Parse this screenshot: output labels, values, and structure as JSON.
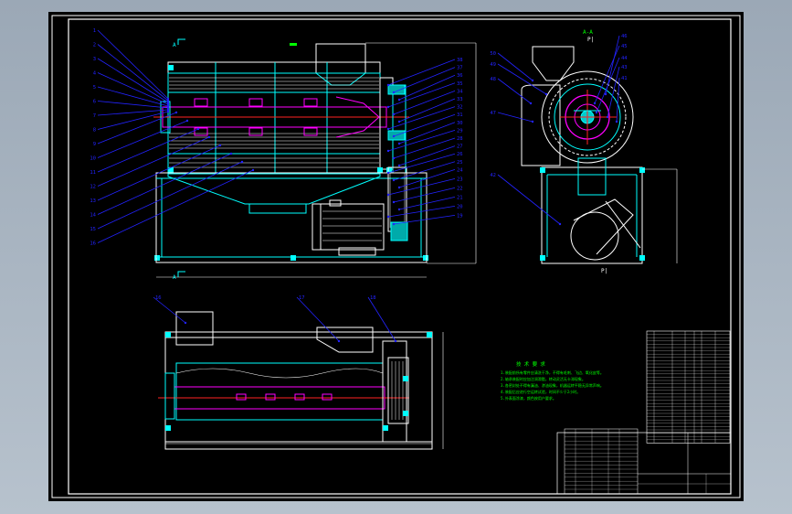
{
  "drawing": {
    "colors": {
      "background": "#000000",
      "frame": "#ffffff",
      "outline": "#00ffff",
      "leader": "#2323ff",
      "hatch": "#ff00ff",
      "centerline": "#ff2020",
      "notes": "#00ff00",
      "table": "#ffffff"
    },
    "front_view_balloons_left": [
      "1",
      "2",
      "3",
      "4",
      "5",
      "6",
      "7",
      "8",
      "9",
      "10",
      "11",
      "12",
      "13",
      "14",
      "15",
      "16"
    ],
    "front_view_balloons_right": [
      "38",
      "37",
      "36",
      "35",
      "34",
      "33",
      "32",
      "31",
      "30",
      "29",
      "28",
      "27",
      "26",
      "25",
      "24",
      "23",
      "22",
      "21",
      "20",
      "19"
    ],
    "side_view_balloons": [
      "50",
      "49",
      "48",
      "47",
      "46",
      "45",
      "44",
      "43",
      "42",
      "41"
    ],
    "plan_view_balloons": [
      "16",
      "17",
      "18"
    ],
    "section_marks": [
      "A",
      "A"
    ],
    "side_view_label": "A-A",
    "tech_notes": {
      "title": "技 术 要 求",
      "lines": [
        "1.装配前所有零件应清洗干净，不得有毛刺、飞边、氧化皮等。",
        "2.轴承装配时应加注润滑脂，转动灵活无卡滞现象。",
        "3.各密封处不得有漏油、渗油现象，机器运转平稳无异常声响。",
        "4.装配后应进行空运转试验，时间不少于2小时。",
        "5.外表面涂漆，颜色按用户要求。"
      ]
    }
  }
}
